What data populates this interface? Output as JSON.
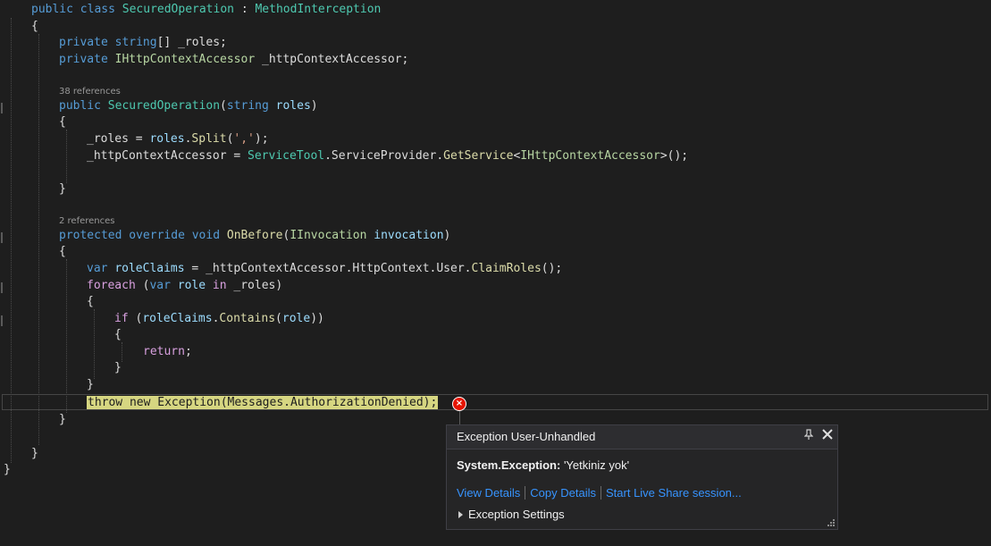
{
  "editor": {
    "lines": [
      [
        [
          "kw",
          "public"
        ],
        [
          "txt",
          " "
        ],
        [
          "kw",
          "class"
        ],
        [
          "txt",
          " "
        ],
        [
          "type",
          "SecuredOperation"
        ],
        [
          "txt",
          " : "
        ],
        [
          "type",
          "MethodInterception"
        ]
      ],
      [
        [
          "txt",
          "{"
        ]
      ],
      [
        [
          "kw",
          "private"
        ],
        [
          "txt",
          " "
        ],
        [
          "kw",
          "string"
        ],
        [
          "txt",
          "[] _roles;"
        ]
      ],
      [
        [
          "kw",
          "private"
        ],
        [
          "txt",
          " "
        ],
        [
          "iface",
          "IHttpContextAccessor"
        ],
        [
          "txt",
          " _httpContextAccessor;"
        ]
      ],
      [
        [
          "kw",
          "public"
        ],
        [
          "txt",
          " "
        ],
        [
          "type",
          "SecuredOperation"
        ],
        [
          "txt",
          "("
        ],
        [
          "kw",
          "string"
        ],
        [
          "txt",
          " "
        ],
        [
          "param",
          "roles"
        ],
        [
          "txt",
          ")"
        ]
      ],
      [
        [
          "txt",
          "{"
        ]
      ],
      [
        [
          "txt",
          "_roles = "
        ],
        [
          "param",
          "roles"
        ],
        [
          "txt",
          "."
        ],
        [
          "method",
          "Split"
        ],
        [
          "txt",
          "("
        ],
        [
          "str",
          "','"
        ],
        [
          "txt",
          ");"
        ]
      ],
      [
        [
          "txt",
          "_httpContextAccessor = "
        ],
        [
          "type",
          "ServiceTool"
        ],
        [
          "txt",
          ".ServiceProvider."
        ],
        [
          "method",
          "GetService"
        ],
        [
          "txt",
          "<"
        ],
        [
          "iface",
          "IHttpContextAccessor"
        ],
        [
          "txt",
          ">();"
        ]
      ],
      [
        [
          "txt",
          "}"
        ]
      ],
      [
        [
          "kw",
          "protected"
        ],
        [
          "txt",
          " "
        ],
        [
          "kw",
          "override"
        ],
        [
          "txt",
          " "
        ],
        [
          "kw",
          "void"
        ],
        [
          "txt",
          " "
        ],
        [
          "method",
          "OnBefore"
        ],
        [
          "txt",
          "("
        ],
        [
          "iface",
          "IInvocation"
        ],
        [
          "txt",
          " "
        ],
        [
          "param",
          "invocation"
        ],
        [
          "txt",
          ")"
        ]
      ],
      [
        [
          "txt",
          "{"
        ]
      ],
      [
        [
          "kw",
          "var"
        ],
        [
          "txt",
          " "
        ],
        [
          "param",
          "roleClaims"
        ],
        [
          "txt",
          " = _httpContextAccessor.HttpContext.User."
        ],
        [
          "method",
          "ClaimRoles"
        ],
        [
          "txt",
          "();"
        ]
      ],
      [
        [
          "ctl",
          "foreach"
        ],
        [
          "txt",
          " ("
        ],
        [
          "kw",
          "var"
        ],
        [
          "txt",
          " "
        ],
        [
          "param",
          "role"
        ],
        [
          "txt",
          " "
        ],
        [
          "ctl",
          "in"
        ],
        [
          "txt",
          " _roles)"
        ]
      ],
      [
        [
          "txt",
          "{"
        ]
      ],
      [
        [
          "ctl",
          "if"
        ],
        [
          "txt",
          " ("
        ],
        [
          "param",
          "roleClaims"
        ],
        [
          "txt",
          "."
        ],
        [
          "method",
          "Contains"
        ],
        [
          "txt",
          "("
        ],
        [
          "param",
          "role"
        ],
        [
          "txt",
          "))"
        ]
      ],
      [
        [
          "txt",
          "{"
        ]
      ],
      [
        [
          "ctl",
          "return"
        ],
        [
          "txt",
          ";"
        ]
      ],
      [
        [
          "txt",
          "}"
        ]
      ],
      [
        [
          "txt",
          "}"
        ]
      ],
      [
        [
          "hl",
          "throw new Exception(Messages.AuthorizationDenied);"
        ]
      ],
      [
        [
          "txt",
          "}"
        ]
      ],
      [
        [
          "txt",
          "}"
        ]
      ],
      [
        [
          "txt",
          "}"
        ]
      ]
    ],
    "codelens": [
      "38 references",
      "2 references"
    ]
  },
  "exception_popup": {
    "title": "Exception User-Unhandled",
    "exception_type": "System.Exception:",
    "message": "'Yetkiniz yok'",
    "links": [
      "View Details",
      "Copy Details",
      "Start Live Share session..."
    ],
    "settings_label": "Exception Settings",
    "icons": {
      "pin": "pin-icon",
      "close": "close-icon",
      "error": "error-icon",
      "expand": "expand-triangle-icon",
      "resize": "resize-grip-icon"
    }
  },
  "colors": {
    "background": "#1e1e1e",
    "keyword": "#569cd6",
    "control": "#d8a0df",
    "type": "#4ec9b0",
    "interface": "#b8d7a3",
    "method": "#dcdcaa",
    "parameter": "#9cdcfe",
    "string": "#d69d85",
    "link": "#3794ff",
    "error": "#e51400",
    "highlight": "#d6d681"
  }
}
